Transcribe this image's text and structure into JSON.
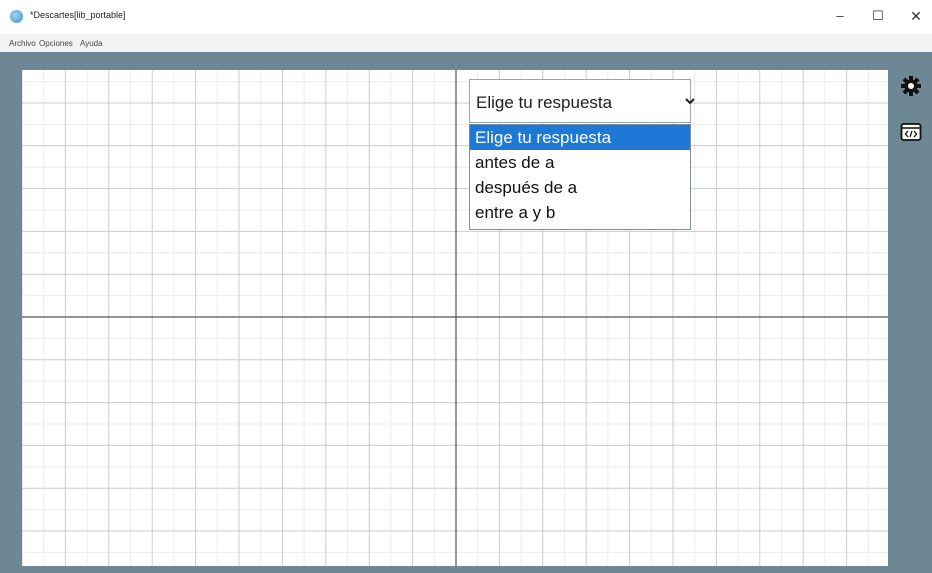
{
  "window": {
    "title": "*Descartes[lib_portable]",
    "buttons": {
      "minimize": "–",
      "maximize": "☐",
      "close": "✕"
    }
  },
  "menu": {
    "items": [
      {
        "label": "Archivo"
      },
      {
        "label": "Opciones"
      },
      {
        "label": "Ayuda"
      }
    ]
  },
  "applet": {
    "background_color": "#6e8795",
    "side_icons": [
      "gear-icon",
      "code-icon"
    ]
  },
  "select": {
    "value": "Elige tu respuesta",
    "options": [
      {
        "label": "Elige tu respuesta",
        "selected": true
      },
      {
        "label": "antes de a",
        "selected": false
      },
      {
        "label": "después de a",
        "selected": false
      },
      {
        "label": "entre a y b",
        "selected": false
      }
    ]
  }
}
